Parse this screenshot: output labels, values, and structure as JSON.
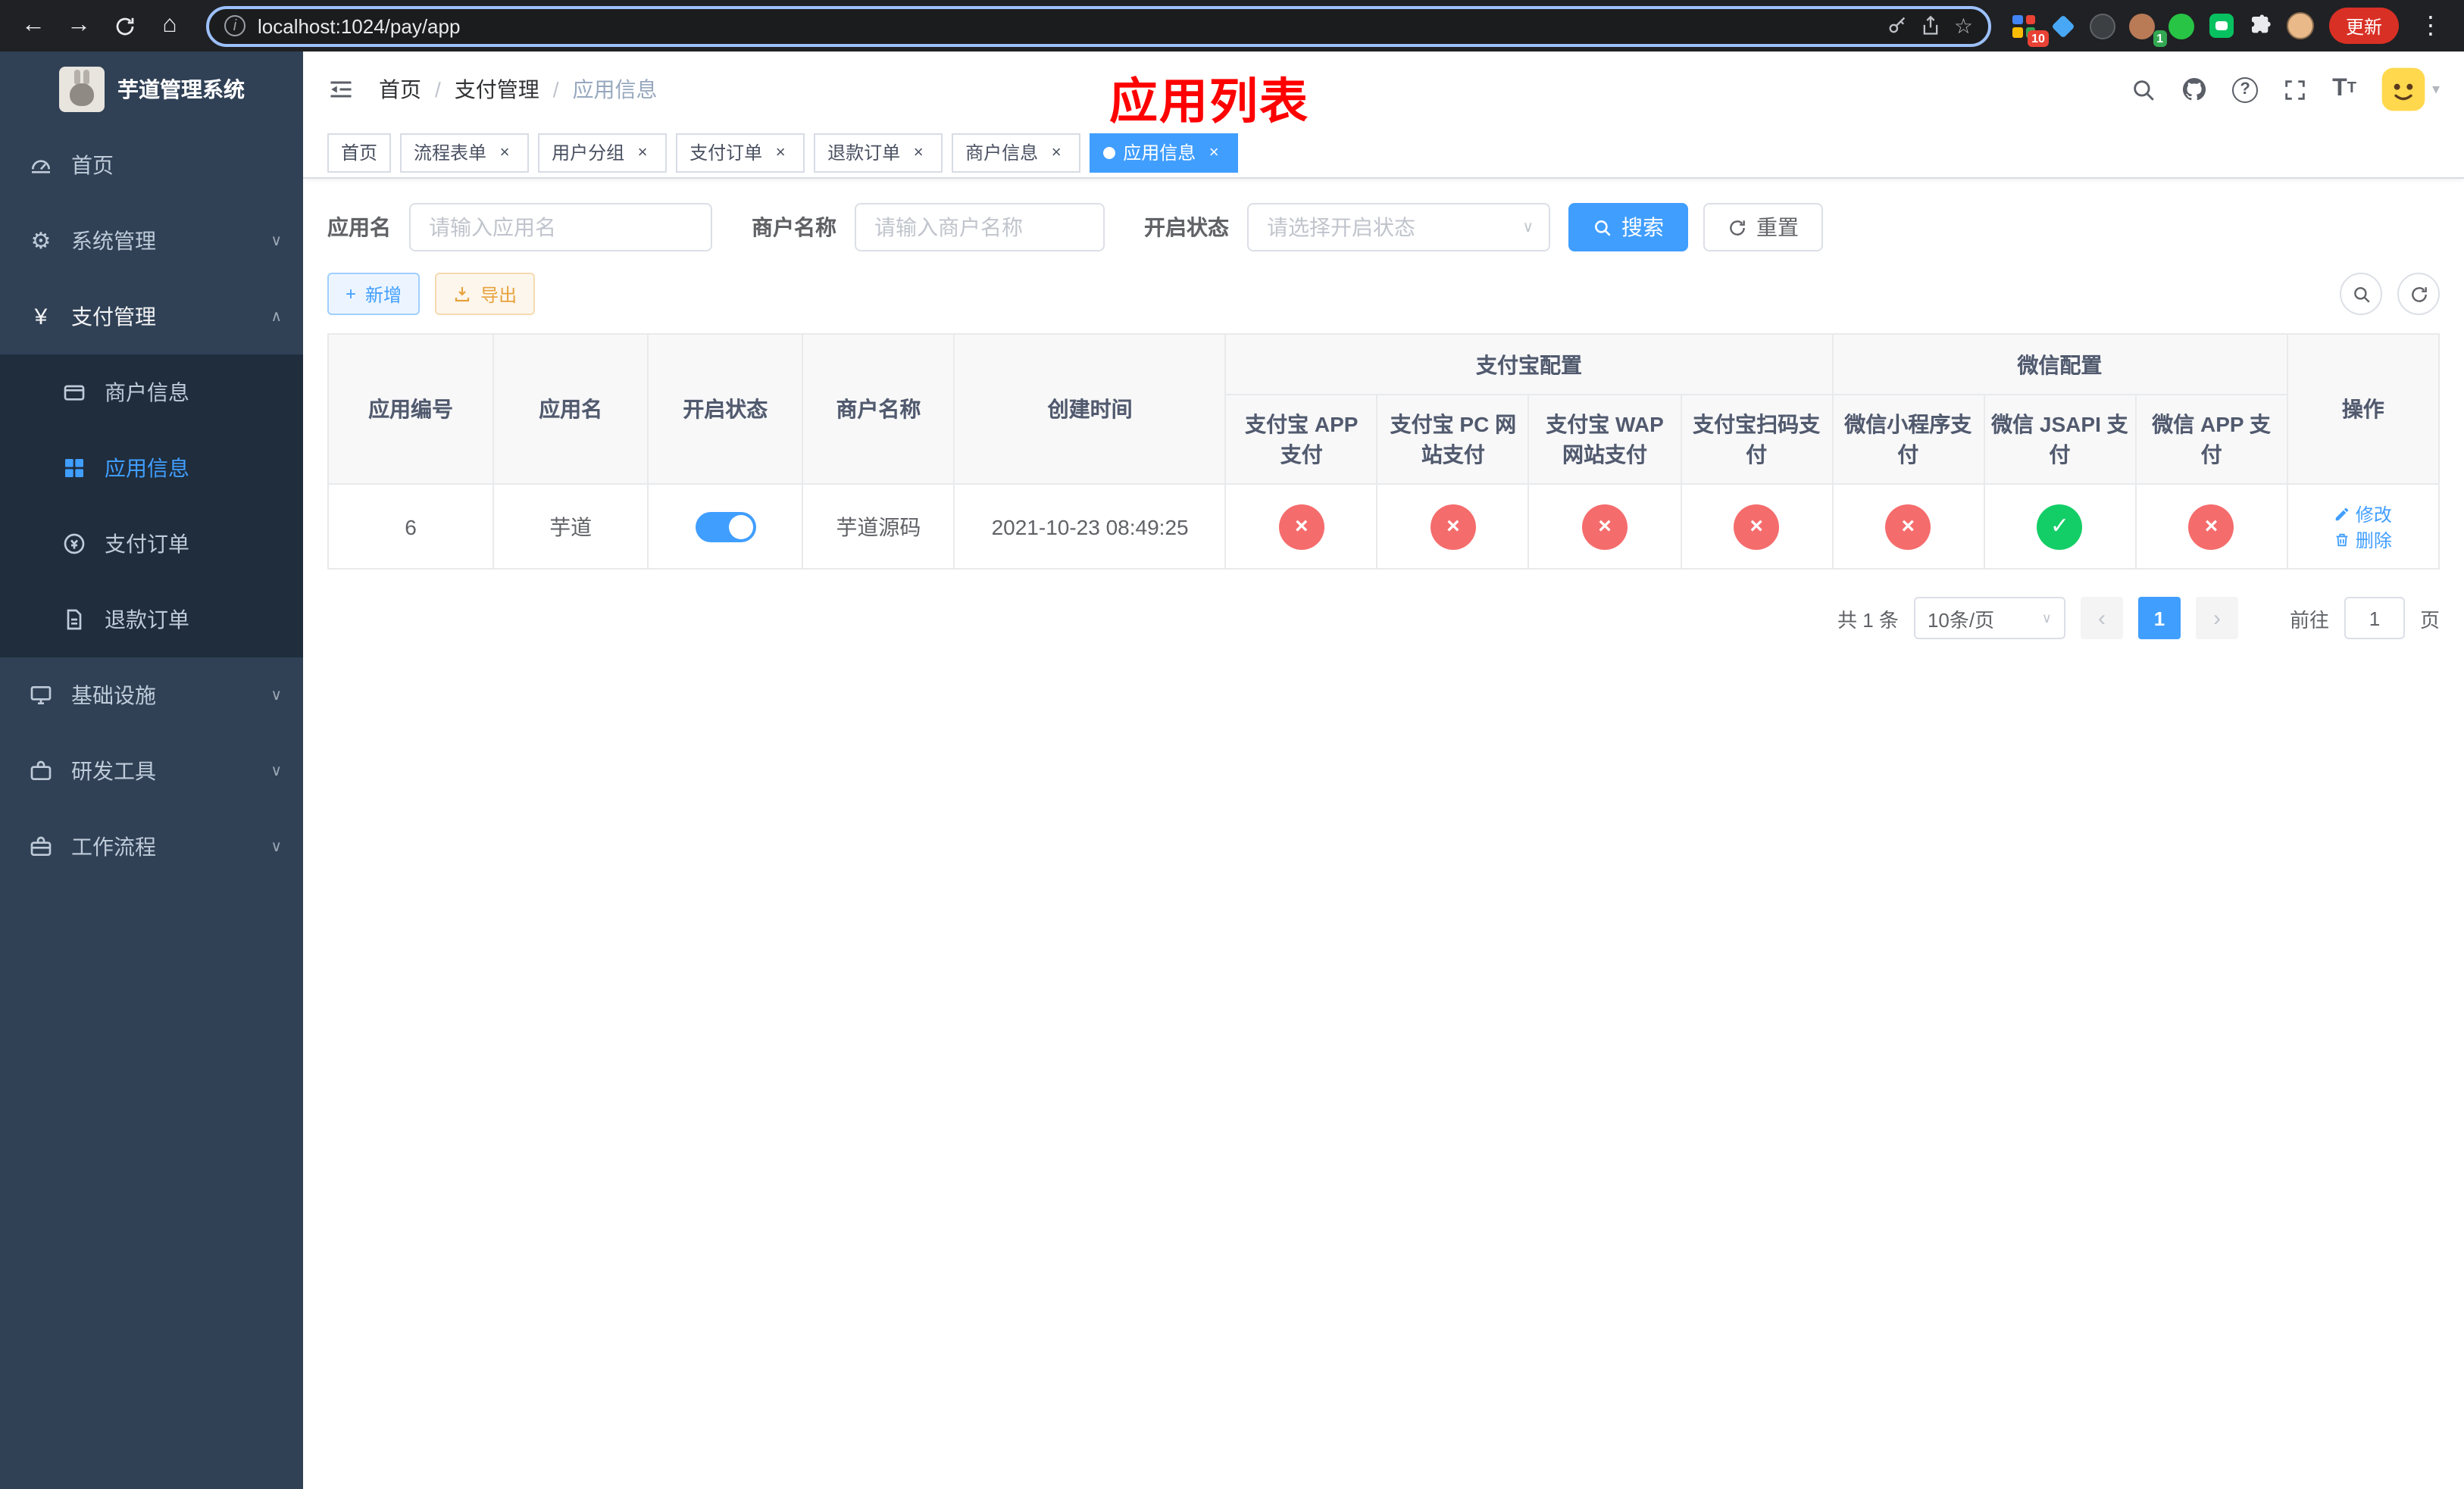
{
  "colors": {
    "primary": "#409eff",
    "success": "#13ce66",
    "danger": "#f56c6c",
    "warning": "#e6a23c",
    "sidebar-bg": "#304156",
    "submenu-bg": "#1f2d3d",
    "annotation": "#ff0000",
    "chrome-bg": "#202124",
    "update-bg": "#d93025"
  },
  "icons": {
    "back": "←",
    "forward": "→",
    "home": "⌂",
    "info": "i",
    "star": "☆",
    "more": "⋮",
    "gear": "⚙",
    "yen": "¥",
    "chevron_down": "∨",
    "chevron_up": "∧",
    "close": "×",
    "check": "✓",
    "cross": "×",
    "question": "?",
    "caret": "▾",
    "plus": "+",
    "prev": "‹",
    "next": "›",
    "letter_t_big": "T",
    "letter_t_small": "T"
  },
  "browser": {
    "url": "localhost:1024/pay/app",
    "update_label": "更新",
    "extension_badge": "10",
    "profile_badge": "1"
  },
  "sidebar": {
    "title": "芋道管理系统",
    "items": [
      {
        "label": "首页"
      },
      {
        "label": "系统管理"
      },
      {
        "label": "支付管理"
      },
      {
        "label": "商户信息"
      },
      {
        "label": "应用信息"
      },
      {
        "label": "支付订单"
      },
      {
        "label": "退款订单"
      },
      {
        "label": "基础设施"
      },
      {
        "label": "研发工具"
      },
      {
        "label": "工作流程"
      }
    ]
  },
  "navbar": {
    "breadcrumb": [
      "首页",
      "支付管理",
      "应用信息"
    ],
    "annotation": "应用列表"
  },
  "tabs": [
    {
      "label": "首页"
    },
    {
      "label": "流程表单"
    },
    {
      "label": "用户分组"
    },
    {
      "label": "支付订单"
    },
    {
      "label": "退款订单"
    },
    {
      "label": "商户信息"
    },
    {
      "label": "应用信息"
    }
  ],
  "filters": {
    "app_name_label": "应用名",
    "app_name_placeholder": "请输入应用名",
    "merchant_label": "商户名称",
    "merchant_placeholder": "请输入商户名称",
    "status_label": "开启状态",
    "status_placeholder": "请选择开启状态",
    "search_label": "搜索",
    "reset_label": "重置"
  },
  "toolbar": {
    "add_label": "新增",
    "export_label": "导出"
  },
  "table": {
    "headers": {
      "app_id": "应用编号",
      "app_name": "应用名",
      "status": "开启状态",
      "merchant": "商户名称",
      "created": "创建时间",
      "alipay_group": "支付宝配置",
      "wechat_group": "微信配置",
      "actions": "操作",
      "alipay_app": "支付宝 APP 支付",
      "alipay_pc": "支付宝 PC 网站支付",
      "alipay_wap": "支付宝 WAP 网站支付",
      "alipay_qr": "支付宝扫码支付",
      "wx_lite": "微信小程序支付",
      "wx_jsapi": "微信 JSAPI 支付",
      "wx_app": "微信 APP 支付"
    },
    "rows": [
      {
        "app_id": "6",
        "app_name": "芋道",
        "status_on": true,
        "merchant": "芋道源码",
        "created": "2021-10-23 08:49:25",
        "channels": [
          false,
          false,
          false,
          false,
          false,
          true,
          false
        ],
        "edit_label": "修改",
        "delete_label": "删除"
      }
    ]
  },
  "pagination": {
    "total_text": "共 1 条",
    "page_size": "10条/页",
    "current_page": "1",
    "goto_label": "前往",
    "goto_value": "1",
    "page_unit": "页"
  }
}
